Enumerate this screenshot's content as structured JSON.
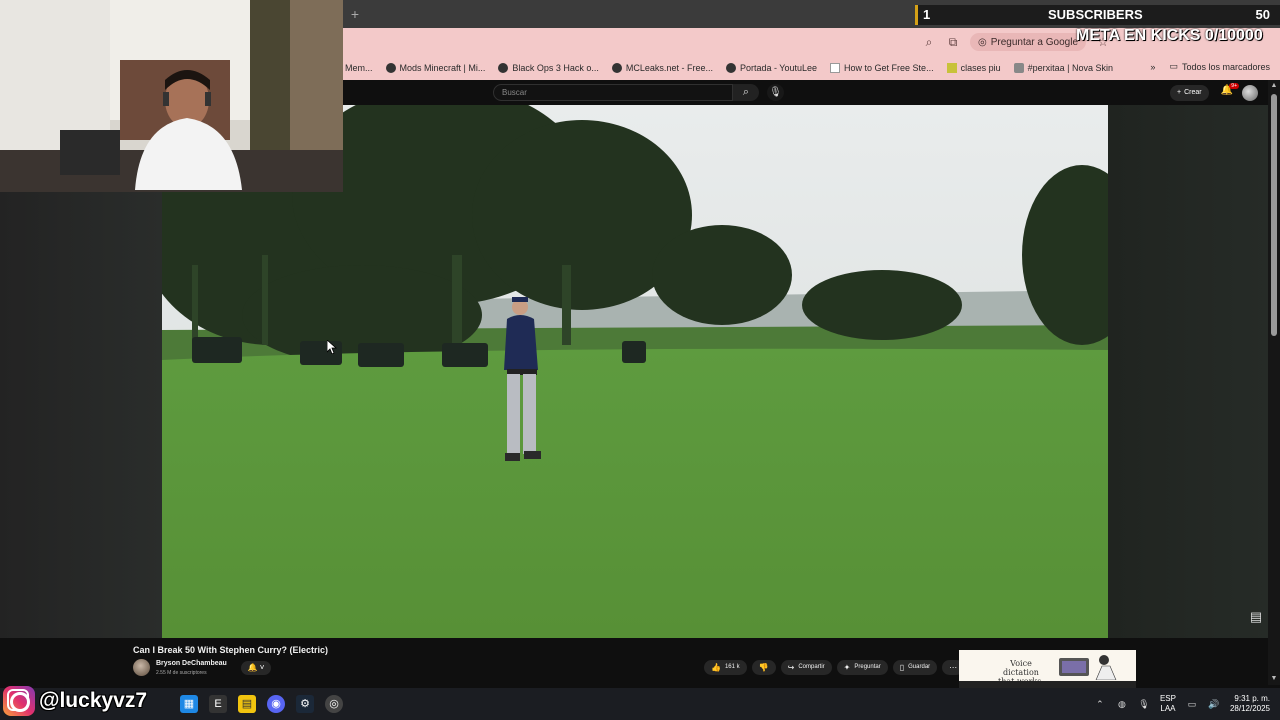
{
  "browser": {
    "omnibar": {
      "ask_google_label": "Preguntar a Google"
    },
    "bookmarks": [
      {
        "label": "Mem...",
        "icon": "none"
      },
      {
        "label": "Mods Minecraft | Mi...",
        "icon": "globe-icon"
      },
      {
        "label": "Black Ops 3 Hack o...",
        "icon": "globe-icon"
      },
      {
        "label": "MCLeaks.net - Free...",
        "icon": "globe-icon"
      },
      {
        "label": "Portada - YoutuLee",
        "icon": "globe-icon"
      },
      {
        "label": "How to Get Free Ste...",
        "icon": "page-icon"
      },
      {
        "label": "clases piu",
        "icon": "classroom-icon"
      },
      {
        "label": "#perxitaa | Nova Skin",
        "icon": "skin-icon"
      }
    ],
    "all_bookmarks_label": "Todos los marcadores"
  },
  "youtube": {
    "search_placeholder": "Buscar",
    "create_label": "Crear",
    "notifications_badge": "9+",
    "video": {
      "title": "Can I Break 50 With Stephen Curry? (Electric)",
      "channel_name": "Bryson DeChambeau",
      "subscribers": "2.55 M de suscriptores",
      "likes": "161 k",
      "share_label": "Compartir",
      "ask_label": "Preguntar",
      "save_label": "Guardar"
    },
    "ad": {
      "text_line1": "Voice dictation",
      "text_line2": "that works."
    }
  },
  "stream_overlay": {
    "sub_counter_current": "1",
    "sub_counter_label": "SUBSCRIBERS",
    "sub_counter_goal": "50",
    "meta_kicks": "META EN KICKS 0/10000",
    "instagram_handle": "@luckyvz7"
  },
  "taskbar": {
    "language_line1": "ESP",
    "language_line2": "LAA",
    "time": "9:31 p. m.",
    "date": "28/12/2025"
  },
  "colors": {
    "omnibar_pink": "#f3c9c9",
    "youtube_dark": "#0f0f0f",
    "grass_green": "#5d9a3f",
    "sub_counter_accent": "#d4a017"
  }
}
